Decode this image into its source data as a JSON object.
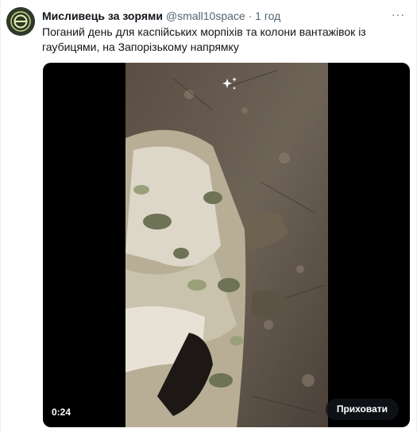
{
  "author": {
    "display_name": "Мисливець за зорями",
    "handle": "@small10space",
    "separator": "·",
    "time": "1 год",
    "avatar_icon": "brand-logo-avatar"
  },
  "tweet": {
    "text": "Поганий день для каспійських морпіхів та колони вантажівок із гаубицями, на Запорізькому напрямку"
  },
  "menu": {
    "icon": "more-options-icon"
  },
  "media": {
    "duration": "0:24",
    "hide_label": "Приховати",
    "sparkle_icon": "sparkle-icon"
  },
  "colors": {
    "text_primary": "#0f1419",
    "text_secondary": "#536471",
    "media_background": "#000000"
  }
}
